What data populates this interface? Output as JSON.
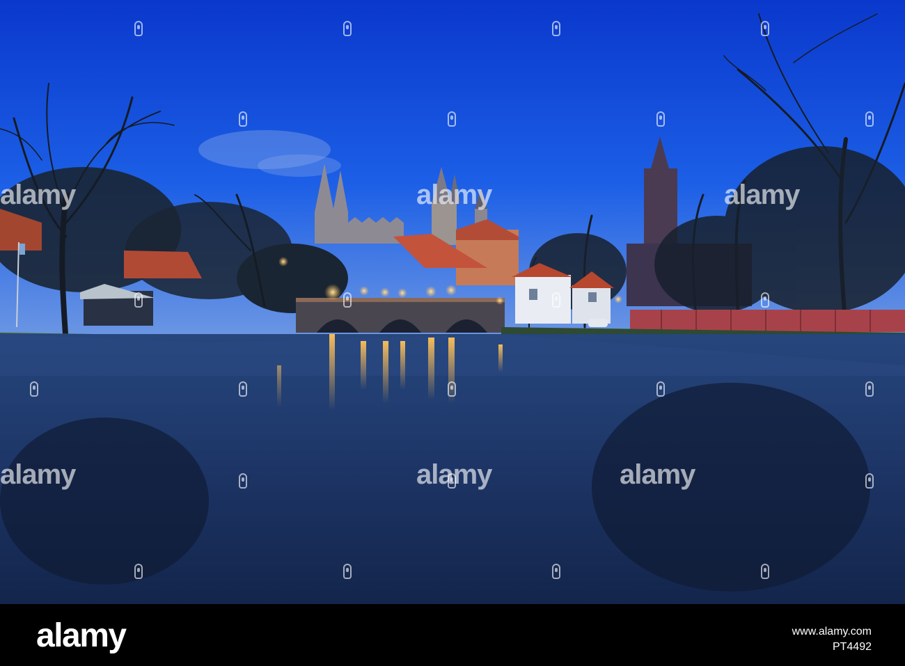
{
  "photo": {
    "subject": "river-town-at-dusk",
    "colors": {
      "sky_top": "#0c3ed6",
      "sky_mid": "#1f62e8",
      "sky_bottom": "#5c8ce6",
      "water": "#1f3a6e",
      "lamp": "#ffb645",
      "roof": "#c4533c"
    }
  },
  "watermark": {
    "text": "alamy"
  },
  "footer": {
    "logo": "alamy",
    "side_line_1": "www.alamy.com",
    "side_line_2": "PT4492"
  }
}
